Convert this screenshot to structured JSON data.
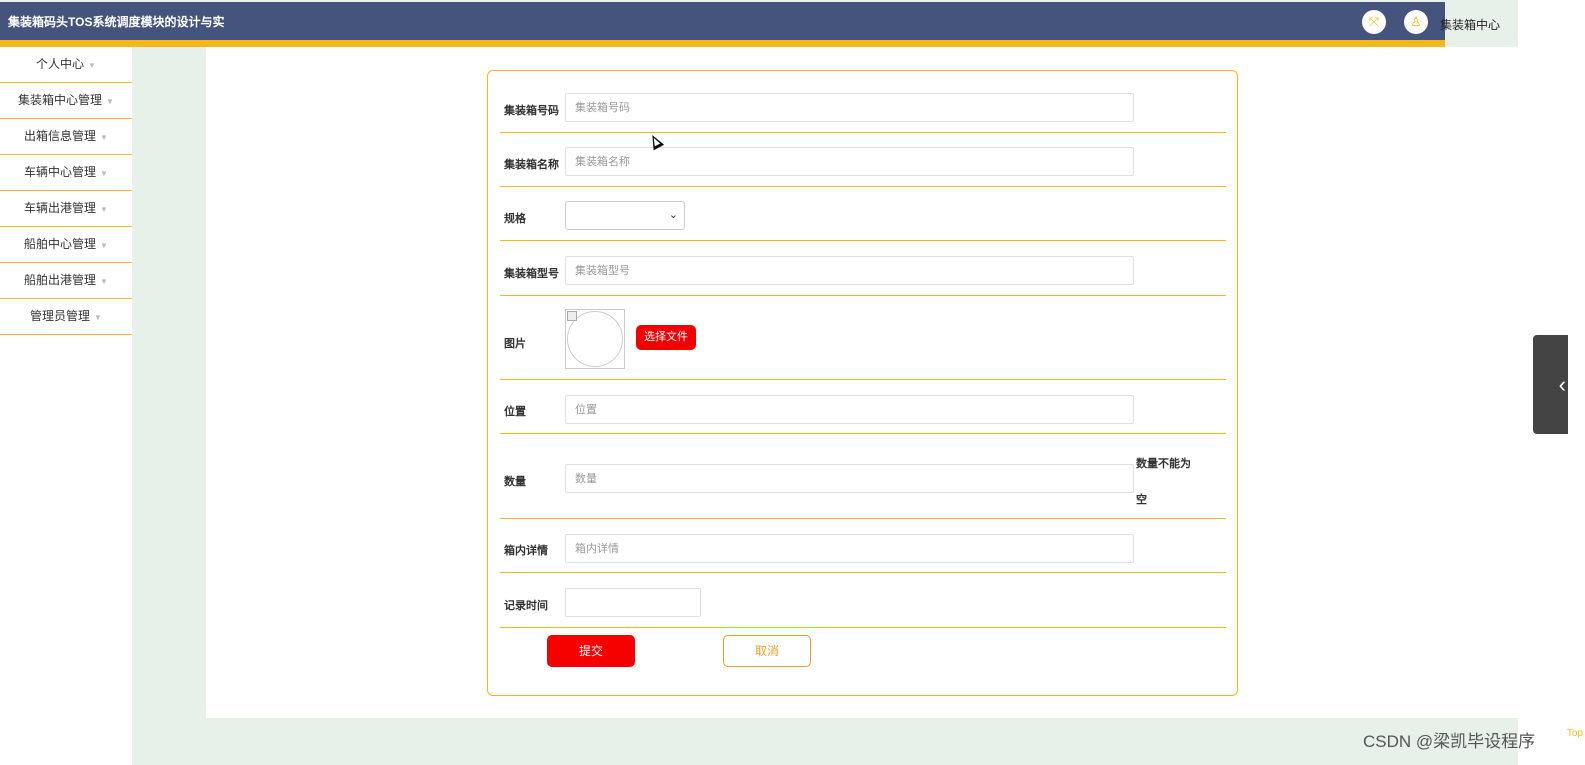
{
  "header": {
    "title": "集装箱码头TOS系统调度模块的设计与实",
    "fullscreen_icon": "expand-icon",
    "user_icon": "user-icon",
    "user_menu_label": "集装箱中心"
  },
  "sidebar": {
    "items": [
      {
        "label": "个人中心"
      },
      {
        "label": "集装箱中心管理"
      },
      {
        "label": "出箱信息管理"
      },
      {
        "label": "车辆中心管理"
      },
      {
        "label": "车辆出港管理"
      },
      {
        "label": "船舶中心管理"
      },
      {
        "label": "船舶出港管理"
      },
      {
        "label": "管理员管理"
      }
    ]
  },
  "form": {
    "container_code": {
      "label": "集装箱号码",
      "placeholder": "集装箱号码",
      "value": ""
    },
    "container_name": {
      "label": "集装箱名称",
      "placeholder": "集装箱名称",
      "value": ""
    },
    "spec": {
      "label": "规格",
      "value": ""
    },
    "container_model": {
      "label": "集装箱型号",
      "placeholder": "集装箱型号",
      "value": ""
    },
    "image": {
      "label": "图片",
      "upload_button": "选择文件"
    },
    "location": {
      "label": "位置",
      "placeholder": "位置",
      "value": ""
    },
    "quantity": {
      "label": "数量",
      "placeholder": "数量",
      "value": "",
      "error": "数量不能为空"
    },
    "details": {
      "label": "箱内详情",
      "placeholder": "箱内详情",
      "value": ""
    },
    "record_time": {
      "label": "记录时间",
      "value": ""
    },
    "submit_label": "提交",
    "cancel_label": "取消"
  },
  "floating": {
    "collapse_icon": "chevron-left-icon",
    "back_to_top_label": "Top"
  },
  "watermark": "CSDN @梁凯毕设程序",
  "colors": {
    "header_bg": "#45547c",
    "accent": "#f4b81e",
    "primary_button": "#f70000",
    "page_bg": "#e8f0ea"
  }
}
